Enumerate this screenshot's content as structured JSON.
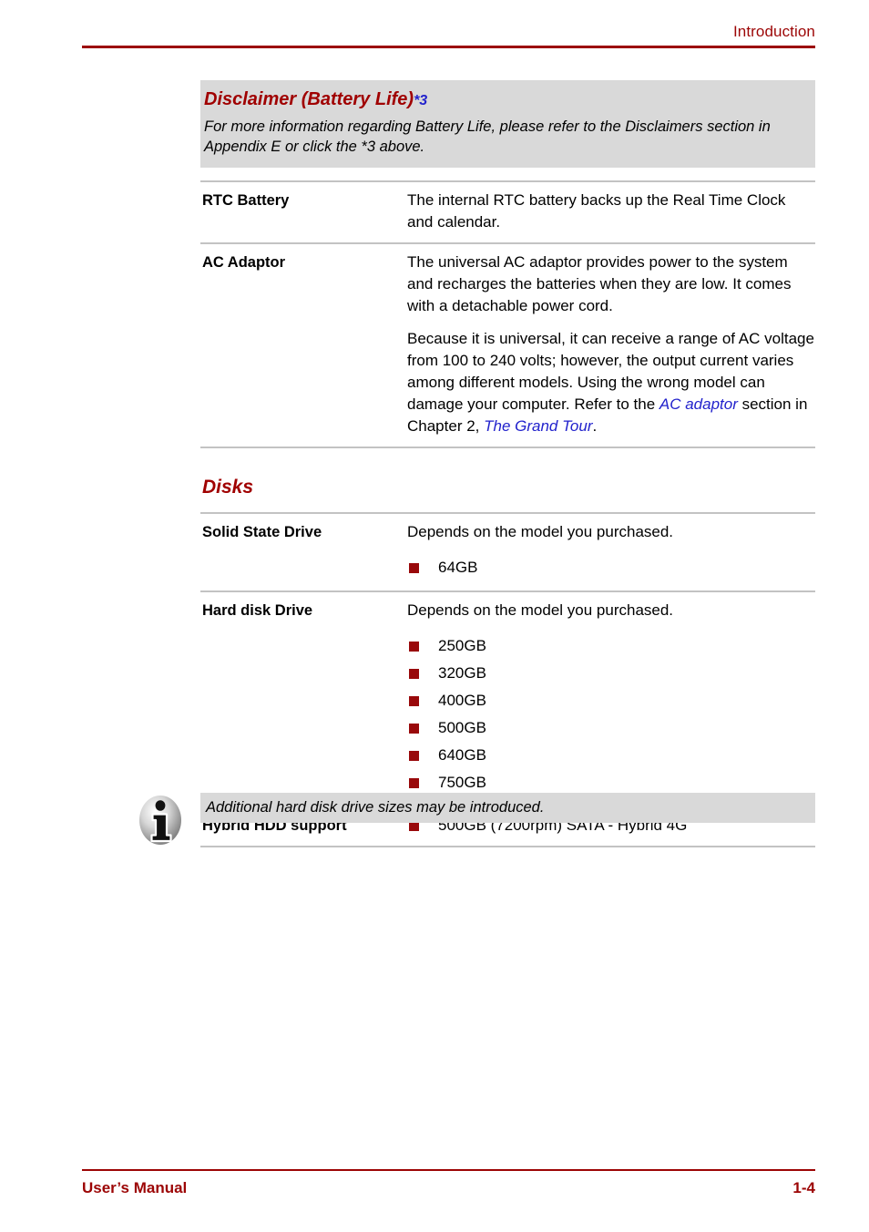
{
  "header": {
    "title": "Introduction",
    "accent_color": "#9c0505"
  },
  "disclaimer": {
    "title": "Disclaimer (Battery Life)",
    "footnote_ref": "*3",
    "body": "For more information regarding Battery Life, please refer to the Disclaimers section in Appendix E or click the *3 above.",
    "background_color": "#d9d9d9",
    "title_color": "#a00000",
    "ref_color": "#2222cc"
  },
  "power_table": {
    "rows": [
      {
        "label": "RTC Battery",
        "paragraphs": [
          "The internal RTC battery backs up the Real Time Clock and calendar."
        ]
      },
      {
        "label": "AC Adaptor",
        "paragraphs": [
          "The universal AC adaptor provides power to the system and recharges the batteries when they are low. It comes with a detachable power cord."
        ],
        "rich_paragraph": {
          "pre": "Because it is universal, it can receive a range of AC voltage from 100 to 240 volts; however, the output current varies among different models. Using the wrong model can damage your computer. Refer to the ",
          "link1": "AC adaptor",
          "mid": " section in Chapter 2, ",
          "link2": "The Grand Tour",
          "post": "."
        }
      }
    ]
  },
  "disks_section": {
    "heading": "Disks",
    "rows": [
      {
        "label": "Solid State Drive",
        "intro": "Depends on the model you purchased.",
        "bullets": [
          "64GB"
        ]
      },
      {
        "label": "Hard disk Drive",
        "intro": "Depends on the model you purchased.",
        "bullets": [
          "250GB",
          "320GB",
          "400GB",
          "500GB",
          "640GB",
          "750GB"
        ]
      },
      {
        "label": "Hybrid HDD support",
        "intro": "",
        "bullets": [
          "500GB (7200rpm) SATA - Hybrid 4G"
        ]
      }
    ],
    "bullet_color": "#99090b"
  },
  "info_note": {
    "icon": "info-icon",
    "text": "Additional hard disk drive sizes may be introduced.",
    "background_color": "#d9d9d9"
  },
  "footer": {
    "left": "User’s Manual",
    "right": "1-4",
    "accent_color": "#9c0505"
  }
}
